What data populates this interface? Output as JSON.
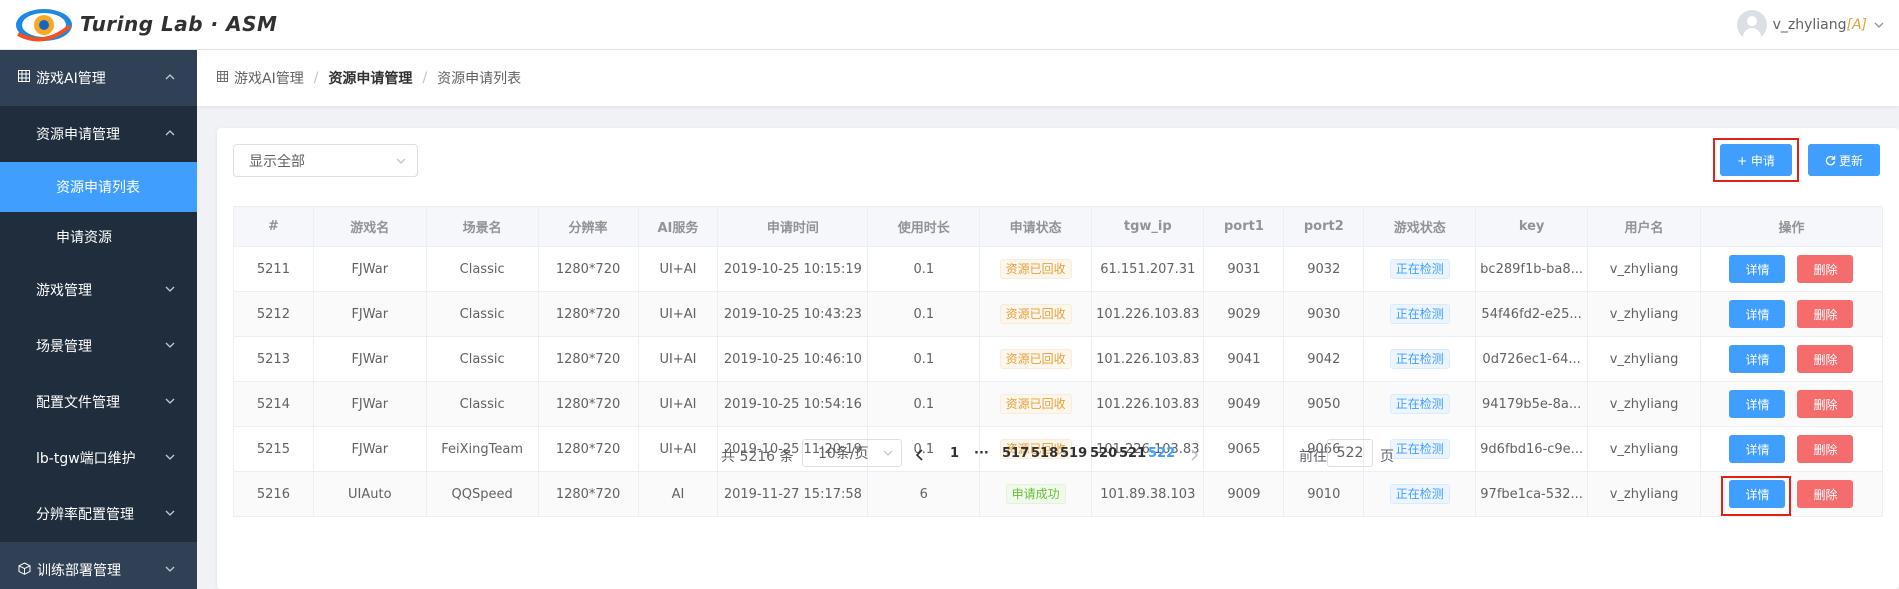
{
  "header": {
    "brand": "Turing Lab · ASM",
    "username": "v_zhyliang",
    "role": "[A]"
  },
  "sidebar": {
    "items": [
      {
        "label": "游戏AI管理",
        "icon": "grid-icon"
      },
      {
        "label": "资源申请管理"
      },
      {
        "label": "资源申请列表"
      },
      {
        "label": "申请资源"
      },
      {
        "label": "游戏管理"
      },
      {
        "label": "场景管理"
      },
      {
        "label": "配置文件管理"
      },
      {
        "label": "lb-tgw端口维护"
      },
      {
        "label": "分辨率配置管理"
      },
      {
        "label": "训练部署管理",
        "icon": "cube-icon"
      }
    ]
  },
  "breadcrumb": {
    "root": "游戏AI管理",
    "parent": "资源申请管理",
    "current": "资源申请列表"
  },
  "filter": {
    "selected": "显示全部"
  },
  "toolbar": {
    "apply_label": "+ 申请",
    "refresh_label": "更新"
  },
  "table": {
    "columns": [
      "#",
      "游戏名",
      "场景名",
      "分辨率",
      "AI服务",
      "申请时间",
      "使用时长",
      "申请状态",
      "tgw_ip",
      "port1",
      "port2",
      "游戏状态",
      "key",
      "用户名",
      "操作"
    ],
    "rows": [
      {
        "id": "5211",
        "game": "FJWar",
        "scene": "Classic",
        "res": "1280*720",
        "ai": "UI+AI",
        "time": "2019-10-25 10:15:19",
        "dur": "0.1",
        "status": "资源已回收",
        "ip": "61.151.207.31",
        "p1": "9031",
        "p2": "9032",
        "gstatus": "正在检测",
        "key": "bc289f1b-ba8...",
        "user": "v_zhyliang"
      },
      {
        "id": "5212",
        "game": "FJWar",
        "scene": "Classic",
        "res": "1280*720",
        "ai": "UI+AI",
        "time": "2019-10-25 10:43:23",
        "dur": "0.1",
        "status": "资源已回收",
        "ip": "101.226.103.83",
        "p1": "9029",
        "p2": "9030",
        "gstatus": "正在检测",
        "key": "54f46fd2-e25...",
        "user": "v_zhyliang"
      },
      {
        "id": "5213",
        "game": "FJWar",
        "scene": "Classic",
        "res": "1280*720",
        "ai": "UI+AI",
        "time": "2019-10-25 10:46:10",
        "dur": "0.1",
        "status": "资源已回收",
        "ip": "101.226.103.83",
        "p1": "9041",
        "p2": "9042",
        "gstatus": "正在检测",
        "key": "0d726ec1-64...",
        "user": "v_zhyliang"
      },
      {
        "id": "5214",
        "game": "FJWar",
        "scene": "Classic",
        "res": "1280*720",
        "ai": "UI+AI",
        "time": "2019-10-25 10:54:16",
        "dur": "0.1",
        "status": "资源已回收",
        "ip": "101.226.103.83",
        "p1": "9049",
        "p2": "9050",
        "gstatus": "正在检测",
        "key": "94179b5e-8a...",
        "user": "v_zhyliang"
      },
      {
        "id": "5215",
        "game": "FJWar",
        "scene": "FeiXingTeam",
        "res": "1280*720",
        "ai": "UI+AI",
        "time": "2019-10-25 11:20:19",
        "dur": "0.1",
        "status": "资源已回收",
        "ip": "101.226.103.83",
        "p1": "9065",
        "p2": "9066",
        "gstatus": "正在检测",
        "key": "9d6fbd16-c9e...",
        "user": "v_zhyliang"
      },
      {
        "id": "5216",
        "game": "UIAuto",
        "scene": "QQSpeed",
        "res": "1280*720",
        "ai": "AI",
        "time": "2019-11-27 15:17:58",
        "dur": "6",
        "status": "申请成功",
        "ip": "101.89.38.103",
        "p1": "9009",
        "p2": "9010",
        "gstatus": "正在检测",
        "key": "97fbe1ca-532...",
        "user": "v_zhyliang"
      }
    ],
    "detail_label": "详情",
    "delete_label": "删除"
  },
  "pagination": {
    "total": "共 5216 条",
    "page_size": "10条/页",
    "pages": [
      "1",
      "···",
      "517",
      "518",
      "519",
      "520",
      "521",
      "522"
    ],
    "current": "522",
    "goto_label": "前往",
    "goto_value": "522",
    "page_word": "页"
  },
  "colors": {
    "primary": "#409eff",
    "danger": "#f56c6c",
    "sidebar": "#304156",
    "highlight": "#e0201a"
  }
}
